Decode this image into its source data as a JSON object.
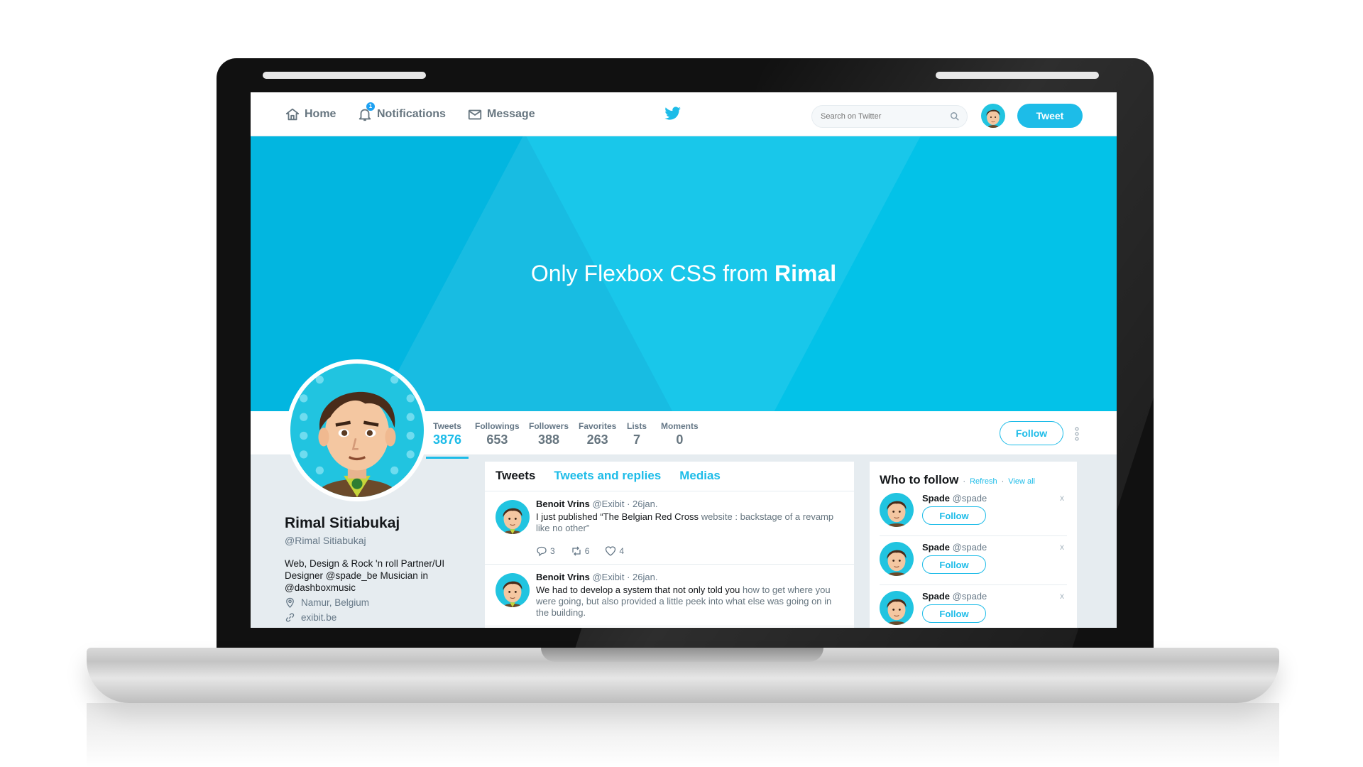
{
  "nav": {
    "home_label": "Home",
    "notifications_label": "Notifications",
    "notifications_count": "1",
    "message_label": "Message",
    "search_placeholder": "Search on Twitter",
    "tweet_button": "Tweet"
  },
  "cover": {
    "title_prefix": "Only Flexbox CSS from",
    "title_bold": "Rimal"
  },
  "stats": [
    {
      "label": "Tweets",
      "value": "3876"
    },
    {
      "label": "Followings",
      "value": "653"
    },
    {
      "label": "Followers",
      "value": "388"
    },
    {
      "label": "Favorites",
      "value": "263"
    },
    {
      "label": "Lists",
      "value": "7"
    },
    {
      "label": "Moments",
      "value": "0"
    }
  ],
  "follow_button": "Follow",
  "profile": {
    "name": "Rimal Sitiabukaj",
    "handle": "@Rimal Sitiabukaj",
    "bio": "Web, Design & Rock 'n roll Partner/UI Designer @spade_be Musician in @dashboxmusic",
    "location": "Namur, Belgium",
    "website": "exibit.be"
  },
  "tabs": [
    "Tweets",
    "Tweets and replies",
    "Medias"
  ],
  "tweets": [
    {
      "author": "Benoit Vrins",
      "handle": "@Exibit",
      "date": "· 26jan.",
      "text_a": "I just published “The Belgian Red Cross",
      "text_b": "website : backstage of a revamp like no other”",
      "replies": "3",
      "retweets": "6",
      "likes": "4"
    },
    {
      "author": "Benoit Vrins",
      "handle": "@Exibit",
      "date": "· 26jan.",
      "text_a": "We had to develop a system that not only told you",
      "text_b": "how to get where you were going, but also provided a little peek into what else was going on in the building."
    }
  ],
  "who_to_follow": {
    "title": "Who to follow",
    "refresh": "Refresh",
    "separator": "·",
    "view_all": "View all",
    "close": "x",
    "items": [
      {
        "name": "Spade",
        "handle": "@spade",
        "button": "Follow"
      },
      {
        "name": "Spade",
        "handle": "@spade",
        "button": "Follow"
      },
      {
        "name": "Spade",
        "handle": "@spade",
        "button": "Follow"
      }
    ]
  },
  "colors": {
    "accent": "#1dbce8",
    "cover": "#03c2e8",
    "text": "#14171a",
    "muted": "#657786"
  }
}
